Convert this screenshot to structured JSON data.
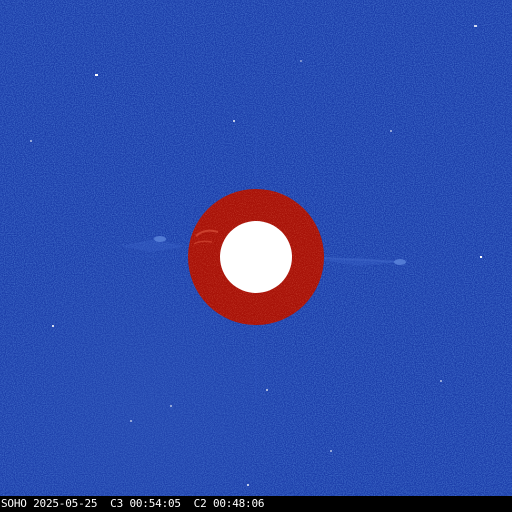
{
  "image": {
    "subject": "SOHO LASCO C3/C2 coronagraph frame",
    "colors": {
      "background": "#1a3aa8",
      "background_dark": "#0f2c93",
      "occulter_ring": "#a81208",
      "occulter_ring_dark": "#8e0b04",
      "sun_disk": "#ffffff",
      "caption_bar": "#000000",
      "caption_text": "#ffffff"
    }
  },
  "caption": {
    "observatory": "SOHO",
    "date": "2025-05-25",
    "c3_label": "C3",
    "c3_time": "00:54:05",
    "c2_label": "C2",
    "c2_time": "00:48:06",
    "full_text": "SOHO 2025-05-25  C3 00:54:05  C2 00:48:06"
  }
}
